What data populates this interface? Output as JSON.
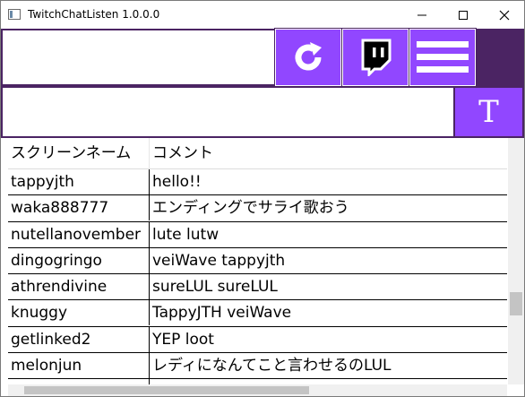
{
  "window": {
    "title": "TwitchChatListen 1.0.0.0"
  },
  "colors": {
    "accent": "#9147ff",
    "dark_purple": "#4b2463"
  },
  "toolbar": {
    "channel_input_value": "",
    "refresh_icon": "refresh-icon",
    "twitch_icon": "twitch-logo-icon",
    "menu_icon": "hamburger-menu-icon",
    "message_input_value": "",
    "font_button_label": "T"
  },
  "grid": {
    "columns": [
      "スクリーンネーム",
      "コメント"
    ],
    "rows": [
      {
        "name": "tappyjth",
        "comment": "hello!!"
      },
      {
        "name": "waka888777",
        "comment": "エンディングでサライ歌おう"
      },
      {
        "name": "nutellanovember",
        "comment": "lute lutw"
      },
      {
        "name": "dingogringo",
        "comment": "veiWave tappyjth"
      },
      {
        "name": "athrendivine",
        "comment": "sureLUL sureLUL"
      },
      {
        "name": "knuggy",
        "comment": "TappyJTH veiWave"
      },
      {
        "name": "getlinked2",
        "comment": "YEP loot"
      },
      {
        "name": "melonjun",
        "comment": "レディになんてこと言わせるのLUL"
      },
      {
        "name": "",
        "comment": ""
      }
    ]
  }
}
